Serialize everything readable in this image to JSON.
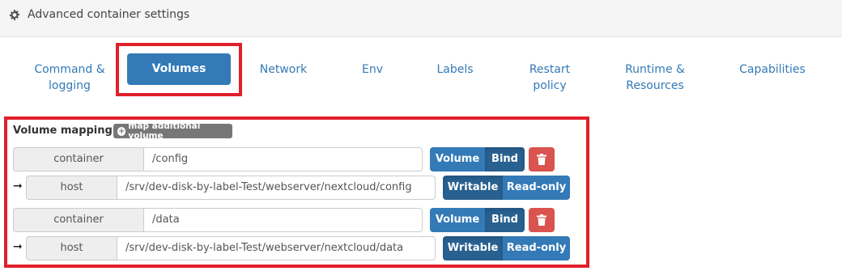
{
  "panel": {
    "title": "Advanced container settings",
    "icon": "gear-icon"
  },
  "tabs": [
    {
      "label": "Command &\nlogging"
    },
    {
      "label": "Volumes",
      "active": true
    },
    {
      "label": "Network"
    },
    {
      "label": "Env"
    },
    {
      "label": "Labels"
    },
    {
      "label": "Restart\npolicy"
    },
    {
      "label": "Runtime &\nResources"
    },
    {
      "label": "Capabilities"
    }
  ],
  "volume_mapping": {
    "label": "Volume mapping",
    "add_button": "map additional volume",
    "mappings": [
      {
        "container_label": "container",
        "container_path": "/config",
        "type_options": [
          "Volume",
          "Bind"
        ],
        "selected_type": "Bind",
        "host_label": "host",
        "host_path": "/srv/dev-disk-by-label-Test/webserver/nextcloud/config",
        "mode_options": [
          "Writable",
          "Read-only"
        ],
        "selected_mode": "Writable"
      },
      {
        "container_label": "container",
        "container_path": "/data",
        "type_options": [
          "Volume",
          "Bind"
        ],
        "selected_type": "Bind",
        "host_label": "host",
        "host_path": "/srv/dev-disk-by-label-Test/webserver/nextcloud/data",
        "mode_options": [
          "Writable",
          "Read-only"
        ],
        "selected_mode": "Writable"
      }
    ]
  },
  "colors": {
    "primary": "#337ab7",
    "primary_active": "#286090",
    "danger": "#d9534f",
    "highlight": "#e0202a"
  }
}
